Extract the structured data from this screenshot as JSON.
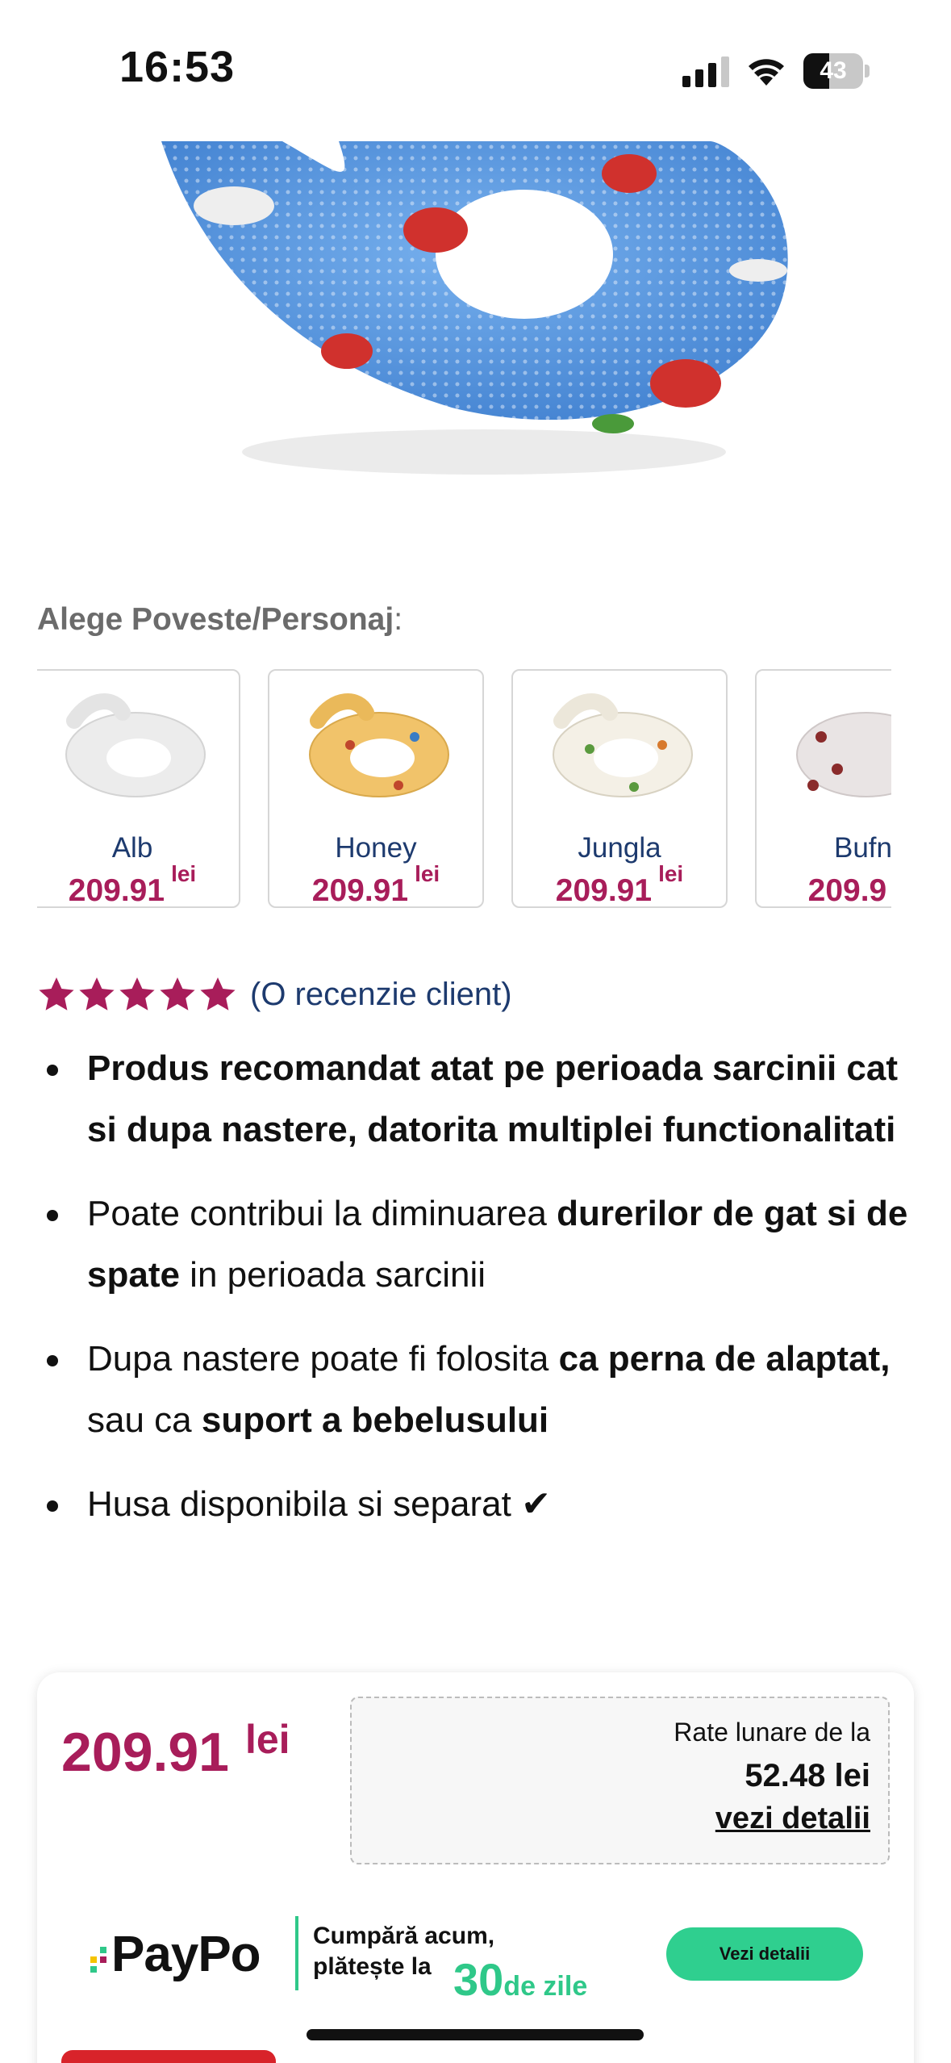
{
  "status_bar": {
    "time": "16:53",
    "battery_level": "43",
    "battery_fraction": 0.43
  },
  "variants": {
    "label": "Alege Poveste/Personaj",
    "label_suffix": ":",
    "items": [
      {
        "name": "Alb",
        "price": "209.91",
        "currency": "lei",
        "color": "#eeeeee"
      },
      {
        "name": "Honey",
        "price": "209.91",
        "currency": "lei",
        "color": "#f1c36a"
      },
      {
        "name": "Jungla",
        "price": "209.91",
        "currency": "lei",
        "color": "#f4f0e6"
      },
      {
        "name": "Bufn",
        "price": "209.9",
        "currency": "lei",
        "color": "#e9e4e4"
      }
    ]
  },
  "rating": {
    "stars": 5,
    "text": "(O recenzie client)"
  },
  "bullets": {
    "b1": "Produs recomandat atat pe perioada sarcinii cat si dupa nastere, datorita multiplei functionalitati",
    "b2_a": "Poate contribui la diminuarea ",
    "b2_b": "durerilor de gat si de spate",
    "b2_c": " in perioada sarcinii",
    "b3_a": "Dupa nastere poate fi folosita ",
    "b3_b": "ca perna de alaptat,",
    "b3_c": " sau ca ",
    "b3_d": "suport a bebelusului",
    "b4": "Husa disponibila si separat ✔"
  },
  "price_box": {
    "price": "209.91",
    "currency": "lei",
    "rates_label": "Rate lunare de la",
    "rates_value": "52.48 lei",
    "rates_link": "vezi detalii"
  },
  "paypo": {
    "logo": "PayPo",
    "line1": "Cumpără acum,",
    "line2": "plătește la",
    "days_num": "30",
    "days_suffix": "de zile",
    "button": "Vezi detalii"
  },
  "colors": {
    "brand": "#a81d5a",
    "link_blue": "#1d3a6e",
    "paypo_green": "#2fc889",
    "hero_blue": "#5b9be0"
  }
}
